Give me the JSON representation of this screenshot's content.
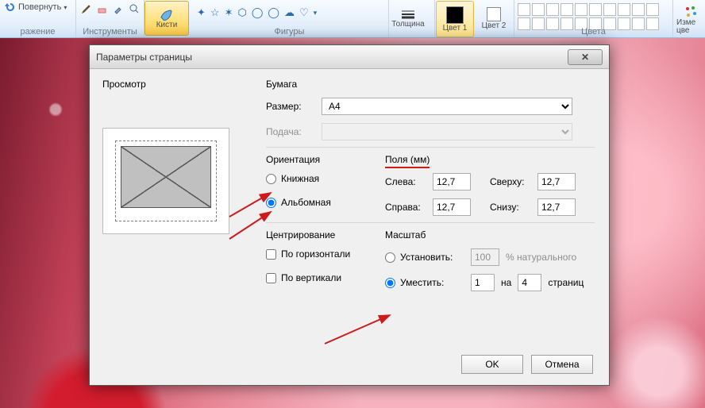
{
  "ribbon": {
    "rotate_label": "Повернуть",
    "rotate_group": "ражение",
    "tools_group": "Инструменты",
    "brushes_label": "Кисти",
    "shapes_group": "Фигуры",
    "thickness_label": "Толщина",
    "color1_label": "Цвет 1",
    "color2_label": "Цвет 2",
    "colors_group": "Цвета",
    "edit_colors_label": "Изме цве"
  },
  "dialog": {
    "title": "Параметры страницы",
    "preview_title": "Просмотр",
    "paper": {
      "title": "Бумага",
      "size_label": "Размер:",
      "size_value": "A4",
      "source_label": "Подача:",
      "source_value": ""
    },
    "orientation": {
      "title": "Ориентация",
      "portrait": "Книжная",
      "landscape": "Альбомная",
      "selected": "landscape"
    },
    "margins": {
      "title": "Поля (мм)",
      "left_label": "Слева:",
      "left_value": "12,7",
      "right_label": "Справа:",
      "right_value": "12,7",
      "top_label": "Сверху:",
      "top_value": "12,7",
      "bottom_label": "Снизу:",
      "bottom_value": "12,7"
    },
    "centering": {
      "title": "Центрирование",
      "horiz": "По горизонтали",
      "vert": "По вертикали"
    },
    "scale": {
      "title": "Масштаб",
      "adjust_label": "Установить:",
      "adjust_value": "100",
      "adjust_unit": "% натурального",
      "fit_label": "Уместить:",
      "fit_wide": "1",
      "fit_sep": "на",
      "fit_tall": "4",
      "fit_unit": "страниц",
      "selected": "fit"
    },
    "ok": "OK",
    "cancel": "Отмена"
  }
}
